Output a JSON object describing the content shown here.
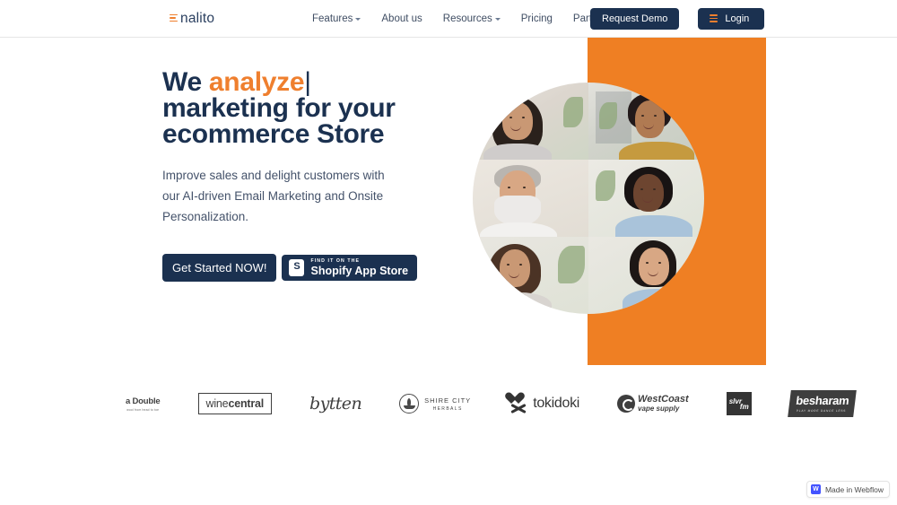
{
  "navbar": {
    "logo_text": "nalito",
    "logo_icon": "enalito-e-bars-icon",
    "links": [
      {
        "label": "Features",
        "has_caret": true
      },
      {
        "label": "About us",
        "has_caret": false
      },
      {
        "label": "Resources",
        "has_caret": true
      },
      {
        "label": "Pricing",
        "has_caret": false
      },
      {
        "label": "Partners",
        "has_caret": false
      }
    ],
    "request_demo_label": "Request Demo",
    "login_label": "Login"
  },
  "hero": {
    "headline_prefix": "We ",
    "headline_accent": "analyze",
    "headline_cursor": "|",
    "headline_line2": "marketing for your",
    "headline_line3": "ecommerce Store",
    "subhead": "Improve sales and delight customers with our AI-driven Email Marketing and Onsite Personalization.",
    "cta_primary": "Get Started NOW!",
    "shopify_small": "FIND IT ON THE",
    "shopify_big": "Shopify App Store",
    "accent_color": "#ef7f2e",
    "orange_block_color": "#ef7f23",
    "navy_color": "#1b3150"
  },
  "clients": [
    {
      "name": "a Double",
      "tagline": "wool from head to toe"
    },
    {
      "name_light": "wine",
      "name_bold": "central"
    },
    {
      "name": "bytten"
    },
    {
      "line1": "SHIRE CITY",
      "line2": "HERBALS"
    },
    {
      "name": "tokidoki"
    },
    {
      "line1": "WestCoast",
      "line2": "vape supply"
    },
    {
      "line1": "slvr",
      "line2": "fm"
    },
    {
      "name": "besharam",
      "tagline": "PLAY MORE DANCE LESS"
    }
  ],
  "footer": {
    "webflow_badge": "Made in Webflow"
  }
}
